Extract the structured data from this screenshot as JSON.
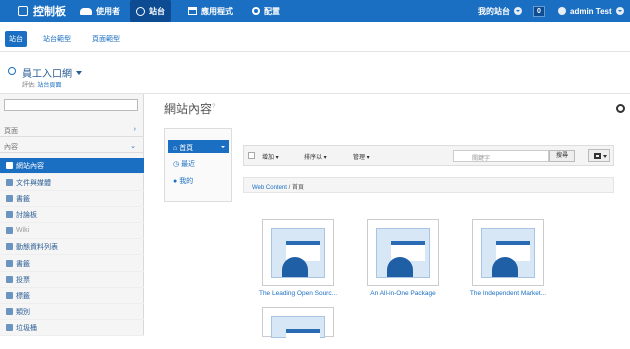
{
  "topbar": {
    "title": "控制板",
    "nav": [
      {
        "label": "使用者"
      },
      {
        "label": "站台"
      },
      {
        "label": "應用程式"
      },
      {
        "label": "配置"
      }
    ],
    "my_site": "我的站台",
    "notifications": "0",
    "user": "admin Test"
  },
  "subnav": {
    "tabs": [
      {
        "label": "站台"
      },
      {
        "label": "站台範型"
      },
      {
        "label": "頁面範型"
      }
    ]
  },
  "page": {
    "title": "員工入口網",
    "subtitle_prefix": "評估:",
    "subtitle_link": "站台頁面"
  },
  "sidebar": {
    "sections": [
      {
        "label": "頁面"
      },
      {
        "label": "內容"
      }
    ],
    "items": [
      {
        "label": "網站內容"
      },
      {
        "label": "文件與媒體"
      },
      {
        "label": "書籤"
      },
      {
        "label": "討論板"
      },
      {
        "label": "Wiki"
      },
      {
        "label": "動態資料列表"
      },
      {
        "label": "書籤"
      },
      {
        "label": "投票"
      },
      {
        "label": "標籤"
      },
      {
        "label": "類別"
      },
      {
        "label": "垃圾桶"
      }
    ]
  },
  "main": {
    "title": "網站內容",
    "help": "?",
    "left_nav": {
      "home": "首頁",
      "recent": "最近",
      "mine": "我的"
    },
    "toolbar": {
      "add": "增加",
      "sort": "排序以",
      "filter": "管理",
      "search_placeholder": "關鍵字",
      "search_button": "搜尋"
    },
    "breadcrumb": {
      "root": "Web Content",
      "sep": "/",
      "current": "首頁"
    },
    "cards": [
      {
        "label": "The Leading Open Sourc..."
      },
      {
        "label": "An All-in-One Package"
      },
      {
        "label": "The Independent Market..."
      },
      {
        "label": ""
      }
    ]
  }
}
